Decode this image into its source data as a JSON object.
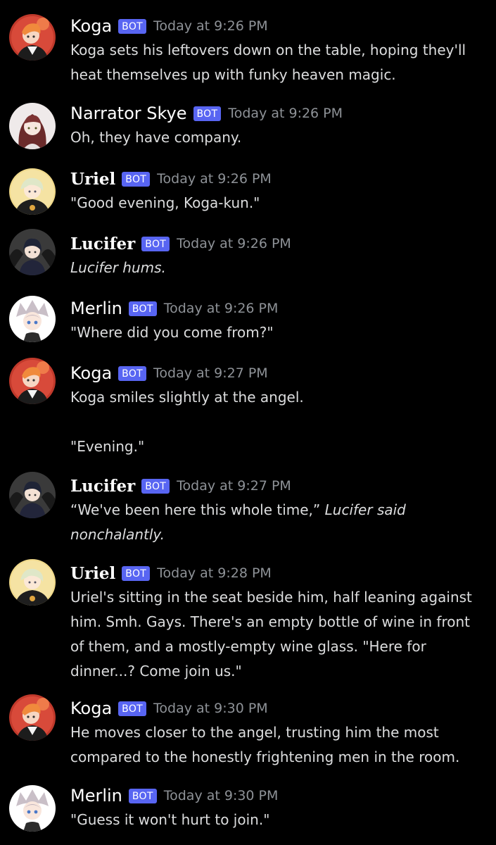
{
  "badge": "BOT",
  "colors": {
    "background": "#000000",
    "name": "#ffffff",
    "body": "#dcddde",
    "timestamp": "#8e9297",
    "bot_badge": "#5865f2"
  },
  "messages": [
    {
      "author": "Koga",
      "time": "Today at 9:26 PM",
      "avatar_icon": "koga-avatar",
      "text": "Koga sets his leftovers down on the table, hoping they'll heat themselves up with funky heaven magic."
    },
    {
      "author": "Narrator Skye",
      "time": "Today at 9:26 PM",
      "avatar_icon": "narrator-skye-avatar",
      "text": "Oh, they have company."
    },
    {
      "author": "Uriel",
      "time": "Today at 9:26 PM",
      "avatar_icon": "uriel-avatar",
      "text": "\"Good evening, Koga-kun.\""
    },
    {
      "author": "Lucifer",
      "time": "Today at 9:26 PM",
      "avatar_icon": "lucifer-avatar",
      "text": "Lucifer hums."
    },
    {
      "author": "Merlin",
      "time": "Today at 9:26 PM",
      "avatar_icon": "merlin-avatar",
      "text": "\"Where did you come from?\""
    },
    {
      "author": "Koga",
      "time": "Today at 9:27 PM",
      "avatar_icon": "koga-avatar",
      "text": "Koga smiles slightly at the angel.",
      "text2": "\"Evening.\""
    },
    {
      "author": "Lucifer",
      "time": "Today at 9:27 PM",
      "avatar_icon": "lucifer-avatar",
      "text": "“We've been here this whole time,”",
      "text_italic": "Lucifer said nonchalantly."
    },
    {
      "author": "Uriel",
      "time": "Today at 9:28 PM",
      "avatar_icon": "uriel-avatar",
      "text": "Uriel's sitting in the seat beside him, half leaning against him. Smh. Gays. There's an empty bottle of wine in front of them, and a mostly-empty wine glass. \"Here for dinner...? Come join us.\""
    },
    {
      "author": "Koga",
      "time": "Today at 9:30 PM",
      "avatar_icon": "koga-avatar",
      "text": "He moves closer to the angel, trusting him the most compared to the honestly frightening men in the room."
    },
    {
      "author": "Merlin",
      "time": "Today at 9:30 PM",
      "avatar_icon": "merlin-avatar",
      "text": "\"Guess it won't hurt to join.\""
    }
  ]
}
